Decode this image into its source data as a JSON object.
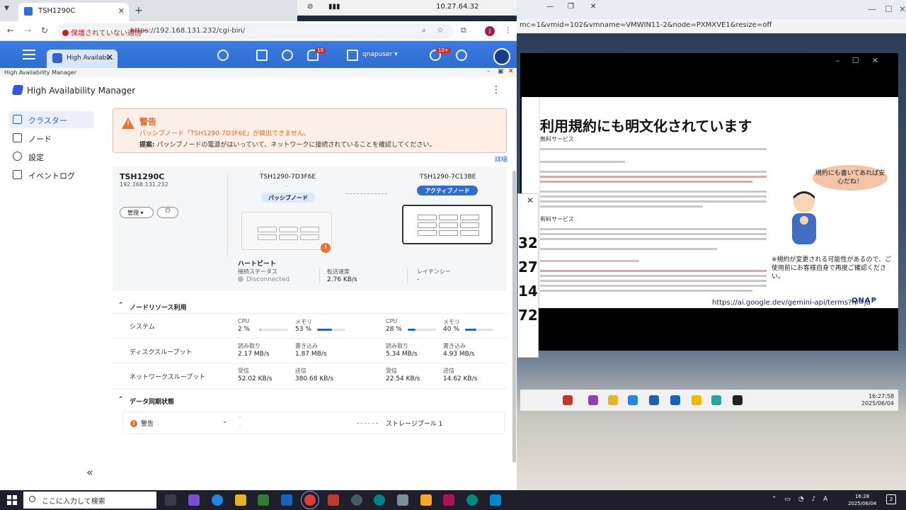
{
  "browser": {
    "tab_title": "TSH1290C",
    "insecure_label": "保護されていない通信",
    "url_scheme": "https",
    "url_rest": "://192.168.131.232/cgi-bin/",
    "profile_initial": "J"
  },
  "vnc_toolbar": {
    "address": "10.27.64.32"
  },
  "right_window": {
    "url": "mc=1&vmid=102&vmname=VMWIN11-2&node=PXMXVE1&resize=off"
  },
  "slide": {
    "title": "利用規約にも明文化されています",
    "subtitle": "無料サービス",
    "section_paid": "有料サービス",
    "bubble": "規約にも書いてあれば安心だね！",
    "note": "※規約が変更される可能性があるので、ご使用前にお客様自身で再度ご確認ください。",
    "link": "https://ai.google.dev/gemini-api/terms?hl=ja",
    "logo": "QNAP"
  },
  "dialog_fragment": {
    "numbers": [
      "32",
      "27",
      "14",
      "72"
    ]
  },
  "remote_clock": {
    "time": "16:27:58",
    "date": "2025/06/04"
  },
  "qts": {
    "tab_label": "High Availabi...",
    "notification_count": "10",
    "user": "qnapuser",
    "update_badge": "10+"
  },
  "app": {
    "window_title": "High Availability Manager",
    "title": "High Availability Manager",
    "sidebar": [
      {
        "label": "クラスター",
        "icon": "cluster-icon"
      },
      {
        "label": "ノード",
        "icon": "node-icon"
      },
      {
        "label": "設定",
        "icon": "gear-icon"
      },
      {
        "label": "イベントログ",
        "icon": "log-icon"
      }
    ],
    "alert": {
      "title": "警告",
      "message": "パッシブノード「TSH1290-7D3F6E」が検出できません。",
      "suggestion_label": "提案:",
      "suggestion": "パッシブノードの電源がはいっていて、ネットワークに接続されていることを確認してください。",
      "detail_link": "詳細"
    },
    "cluster": {
      "name": "TSH1290C",
      "ip": "192.168.131.232",
      "manage_label": "管理",
      "node_a": {
        "name": "TSH1290-7D3F6E",
        "status_dash": "-",
        "role": "パッシブノード"
      },
      "node_b": {
        "name": "TSH1290-7C13BE",
        "role": "アクティブノード"
      },
      "heartbeat": {
        "title": "ハートビート",
        "conn_label": "接続ステータス",
        "conn_value": "Disconnected",
        "speed_label": "転送速度",
        "speed_value": "2.76 KB/s",
        "latency_label": "レイテンシー",
        "latency_value": "-"
      }
    },
    "resources": {
      "title": "ノードリソース利用",
      "system_label": "システム",
      "disk_label": "ディスクスループット",
      "network_label": "ネットワークスループット",
      "cpu_label": "CPU",
      "mem_label": "メモリ",
      "read_label": "読み取り",
      "write_label": "書き込み",
      "recv_label": "受信",
      "send_label": "送信",
      "node_a": {
        "cpu": "2 %",
        "cpu_fraction": 0.02,
        "mem": "53 %",
        "mem_fraction": 0.53,
        "read": "2.17 MB/s",
        "write": "1.87 MB/s",
        "recv": "52.02 KB/s",
        "send": "380.68 KB/s"
      },
      "node_b": {
        "cpu": "28 %",
        "cpu_fraction": 0.28,
        "mem": "40 %",
        "mem_fraction": 0.4,
        "read": "5.34 MB/s",
        "write": "4.93 MB/s",
        "recv": "22.54 KB/s",
        "send": "14.62 KB/s"
      }
    },
    "sync": {
      "title": "データ同期状態",
      "status": "警告",
      "dash_top": "-",
      "dash_bottom": "-",
      "pool": "ストレージプール 1"
    }
  },
  "taskbar": {
    "search_placeholder": "ここに入力して検索",
    "time": "16:28",
    "date": "2025/06/04",
    "notif_count": "2"
  }
}
